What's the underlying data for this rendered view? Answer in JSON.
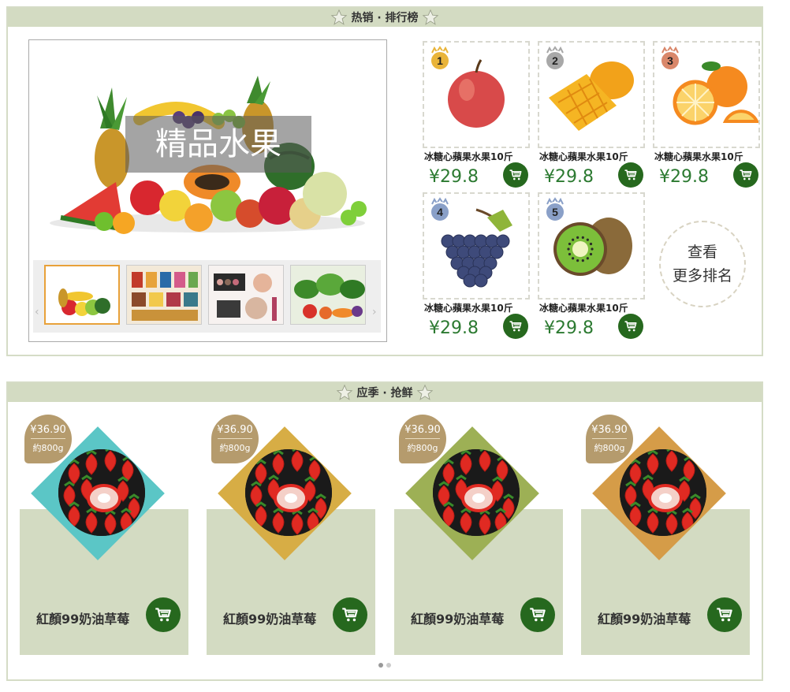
{
  "hot_ranking": {
    "title": "热销 · 排行榜",
    "hero": {
      "caption": "精品水果"
    },
    "thumbnails": [
      "fruit-assortment",
      "snack-shelf",
      "cosmetics",
      "vegetables"
    ],
    "prev_arrow": "‹",
    "next_arrow": "›",
    "products": [
      {
        "rank": "1",
        "fruit": "apple",
        "name": "冰糖心蘋果水果10斤",
        "price": "¥29.8"
      },
      {
        "rank": "2",
        "fruit": "mango",
        "name": "冰糖心蘋果水果10斤",
        "price": "¥29.8"
      },
      {
        "rank": "3",
        "fruit": "orange",
        "name": "冰糖心蘋果水果10斤",
        "price": "¥29.8"
      },
      {
        "rank": "4",
        "fruit": "grapes",
        "name": "冰糖心蘋果水果10斤",
        "price": "¥29.8"
      },
      {
        "rank": "5",
        "fruit": "kiwi",
        "name": "冰糖心蘋果水果10斤",
        "price": "¥29.8"
      }
    ],
    "more_line1": "查看",
    "more_line2": "更多排名"
  },
  "season_fresh": {
    "title": "应季 · 抢鲜",
    "items": [
      {
        "price": "¥36.90",
        "weight": "約800g",
        "name": "紅顏99奶油草莓",
        "accent": "#5bc6c6"
      },
      {
        "price": "¥36.90",
        "weight": "約800g",
        "name": "紅顏99奶油草莓",
        "accent": "#d7ad45"
      },
      {
        "price": "¥36.90",
        "weight": "約800g",
        "name": "紅顏99奶油草莓",
        "accent": "#9db055"
      },
      {
        "price": "¥36.90",
        "weight": "約800g",
        "name": "紅顏99奶油草莓",
        "accent": "#d59c48"
      }
    ],
    "pager_dots": 2
  },
  "colors": {
    "brand_green": "#26681e",
    "price_green": "#2c7a31",
    "header_bg": "#d3dbc2",
    "tag_bg": "#b59b6d"
  }
}
